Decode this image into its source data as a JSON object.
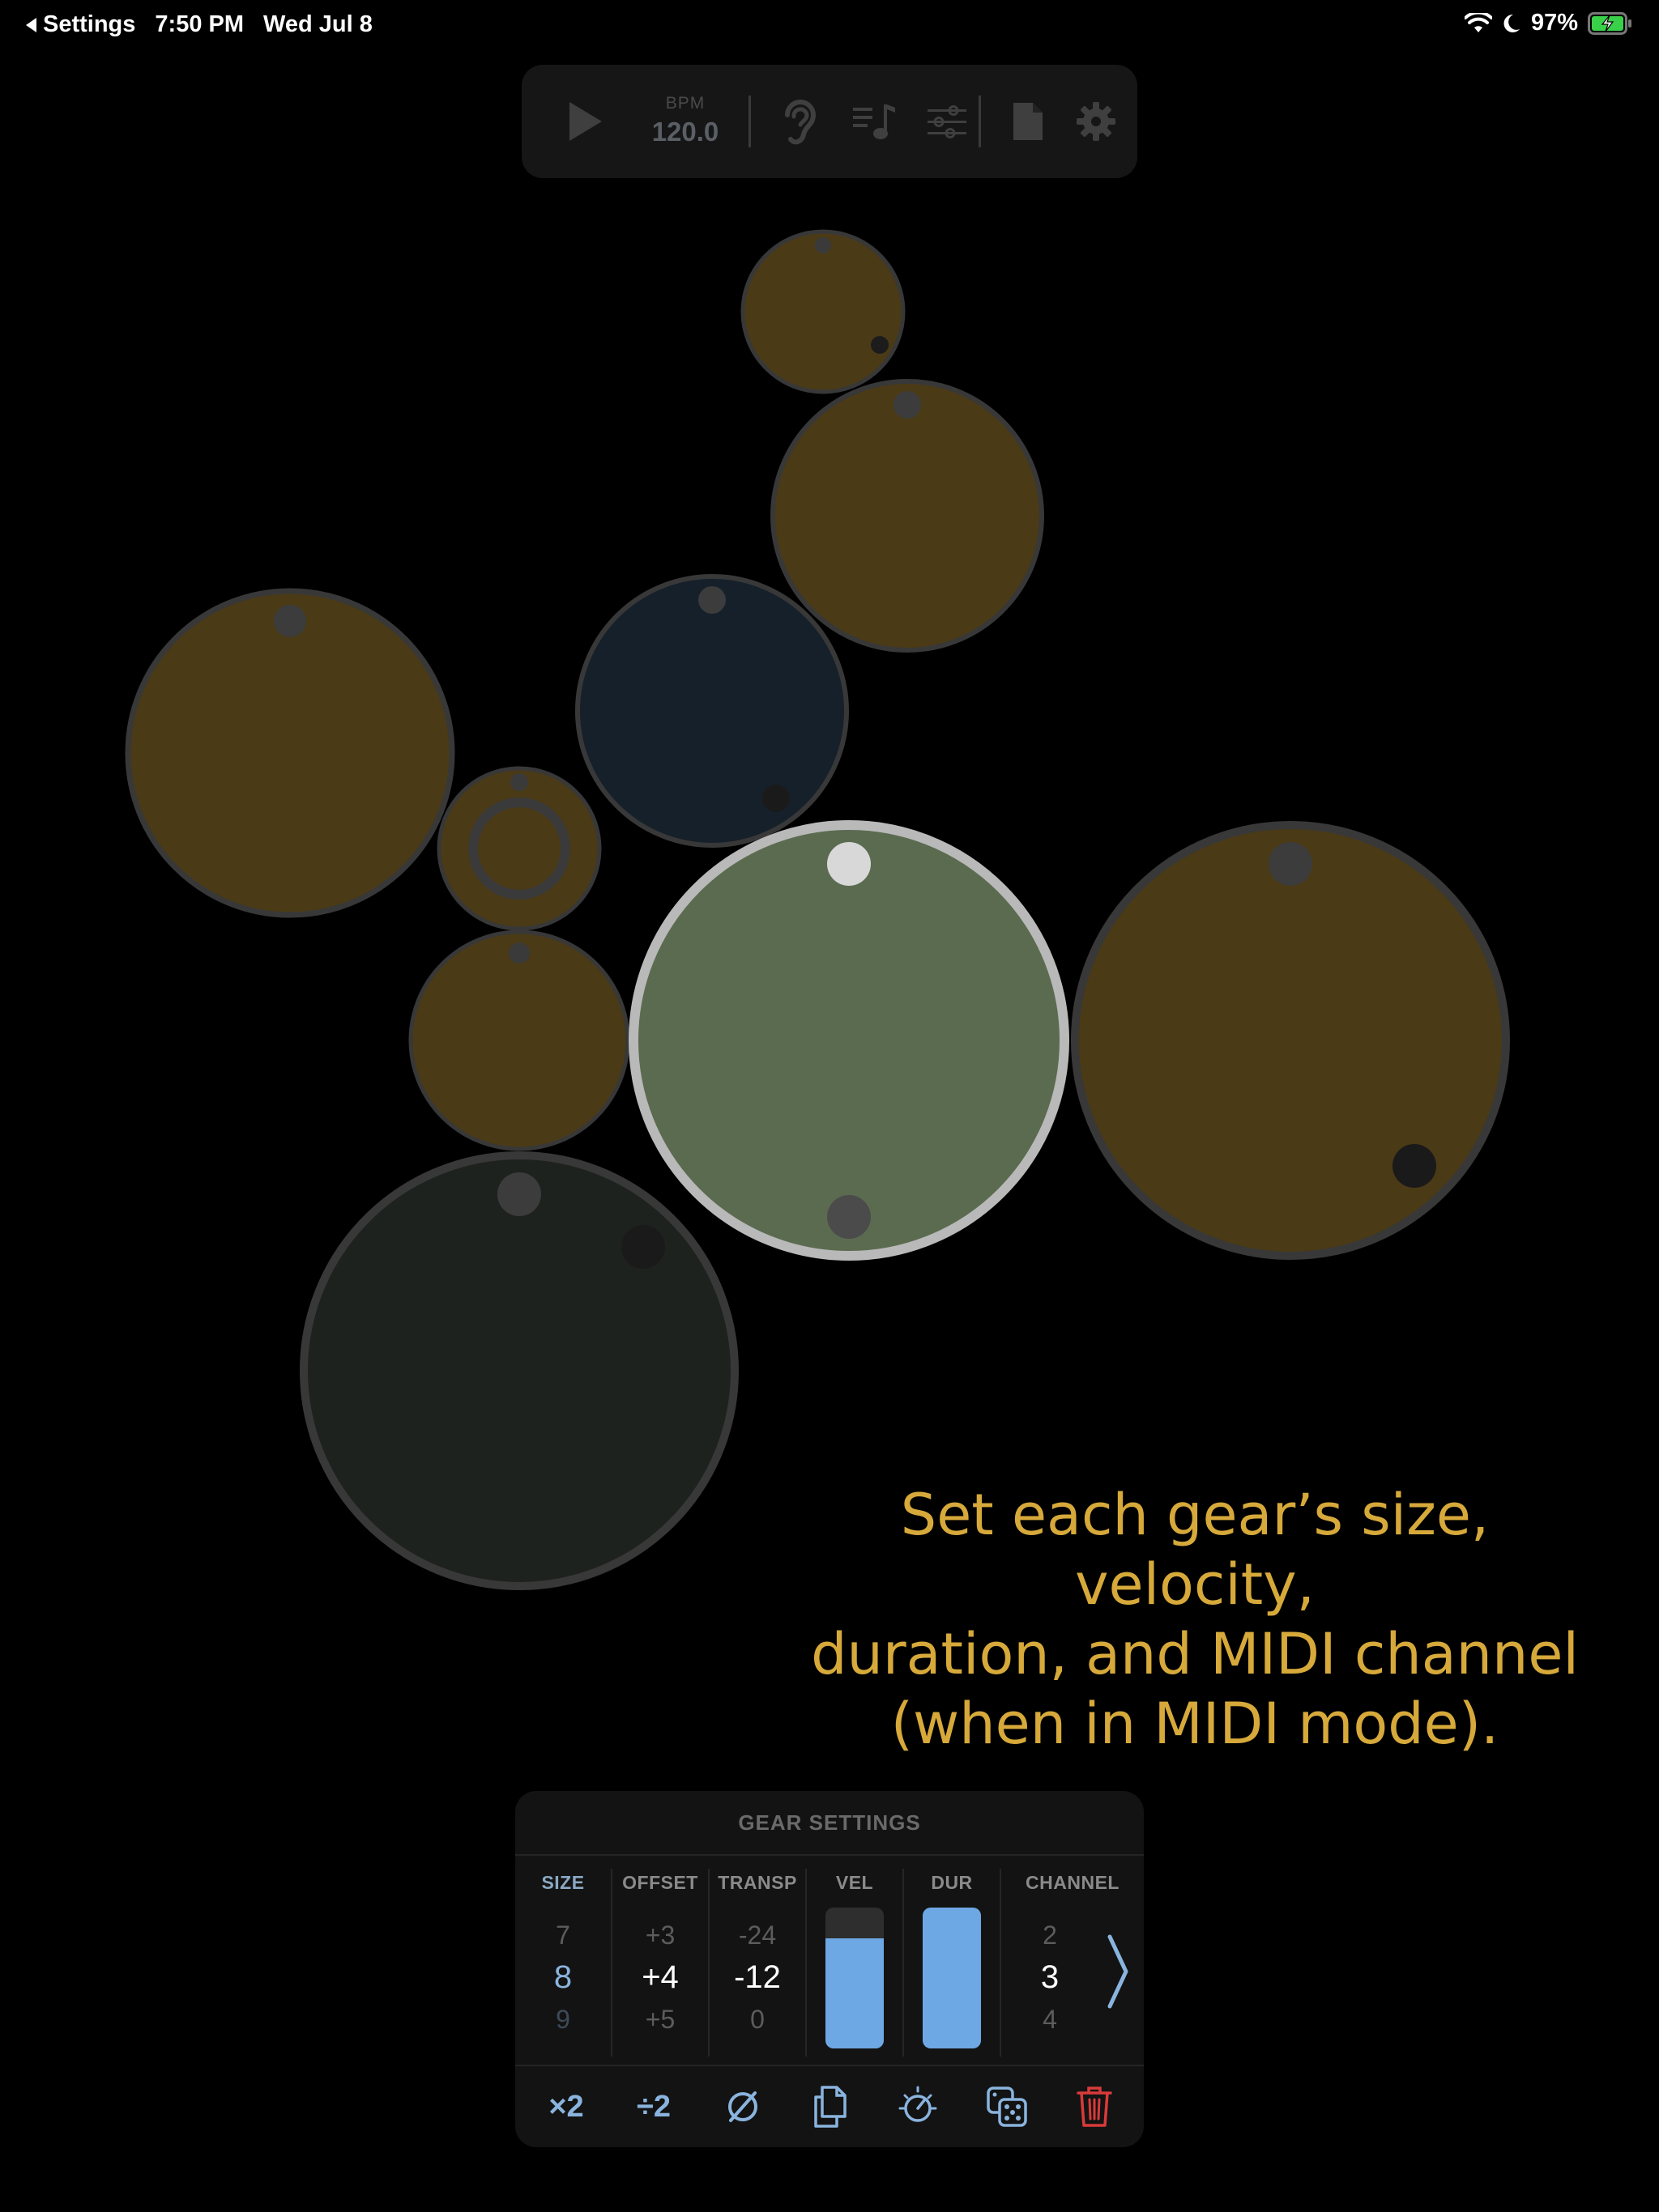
{
  "status_bar": {
    "back_label": "Settings",
    "time": "7:50 PM",
    "date": "Wed Jul 8",
    "battery": "97%"
  },
  "toolbar": {
    "bpm_label": "BPM",
    "bpm_value": "120.0",
    "icons": [
      "play-icon",
      "ear-icon",
      "note-list-icon",
      "sliders-icon",
      "document-icon",
      "gear-icon"
    ]
  },
  "caption": {
    "line1": "Set each gear’s size, velocity,",
    "line2": "duration, and MIDI channel",
    "line3": "(when in MIDI mode)."
  },
  "gear_settings": {
    "title": "GEAR SETTINGS",
    "size": {
      "label": "SIZE",
      "prev": "7",
      "current": "8",
      "next": "9"
    },
    "offset": {
      "label": "OFFSET",
      "prev": "+3",
      "current": "+4",
      "next": "+5"
    },
    "transp": {
      "label": "TRANSP",
      "prev": "-24",
      "current": "-12",
      "next": "0"
    },
    "vel": {
      "label": "VEL",
      "level": 0.78
    },
    "dur": {
      "label": "DUR",
      "level": 1.0
    },
    "channel": {
      "label": "CHANNEL",
      "prev": "2",
      "current": "3",
      "next": "4"
    },
    "actions": {
      "double": "×2",
      "halve": "÷2"
    }
  },
  "colors": {
    "gear_gold": "#4a3a16",
    "gear_navy": "#16202a",
    "gear_dark": "#1e221e",
    "gear_selected": "#5b6b50",
    "caption": "#d6a93a",
    "accent_blue": "#8ab4de",
    "delete_red": "#d93a3a"
  }
}
